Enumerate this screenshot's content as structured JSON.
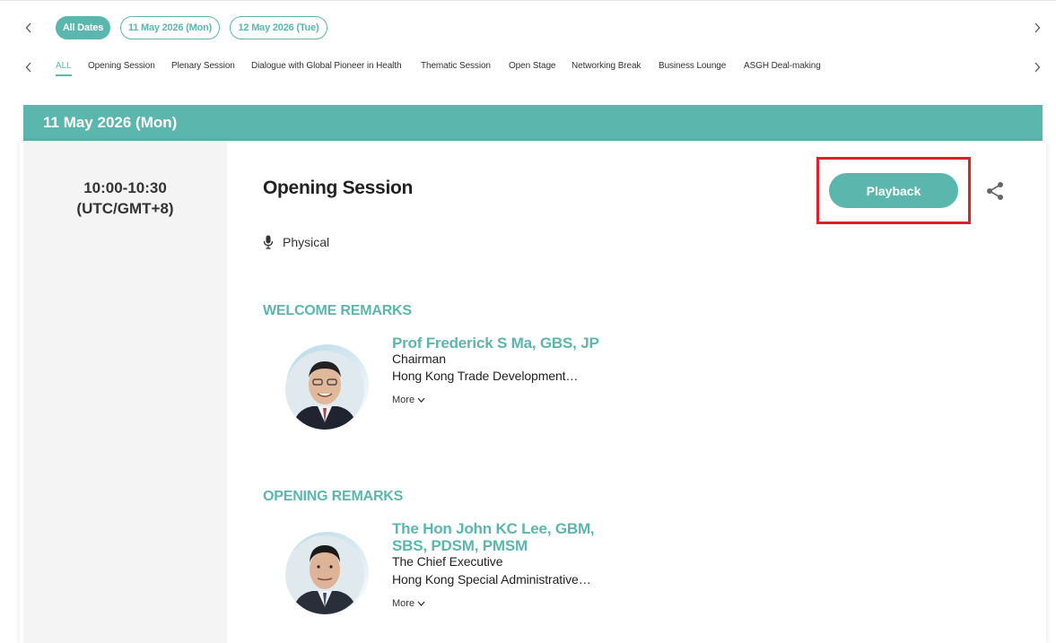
{
  "date_filters": {
    "prev_label": "‹",
    "next_label": "›",
    "items": [
      {
        "label": "All Dates",
        "active": true
      },
      {
        "label": "11 May 2026 (Mon)",
        "active": false
      },
      {
        "label": "12 May 2026 (Tue)",
        "active": false
      }
    ]
  },
  "category_tabs": {
    "items": [
      {
        "label": "ALL",
        "active": true
      },
      {
        "label": "Opening Session"
      },
      {
        "label": "Plenary Session"
      },
      {
        "label": "Dialogue with Global Pioneer in Health"
      },
      {
        "label": "Thematic Session"
      },
      {
        "label": "Open Stage"
      },
      {
        "label": "Networking Break"
      },
      {
        "label": "Business Lounge"
      },
      {
        "label": "ASGH Deal-making"
      }
    ]
  },
  "day": {
    "header": "11 May 2026 (Mon)"
  },
  "session": {
    "time_line1": "10:00-10:30",
    "time_line2": "(UTC/GMT+8)",
    "title": "Opening Session",
    "playback_label": "Playback",
    "format": "Physical",
    "icons": {
      "share": "share-icon",
      "format": "microphone-icon"
    },
    "sections": [
      {
        "heading": "WELCOME REMARKS",
        "speaker": {
          "name": "Prof Frederick S Ma, GBS, JP",
          "role": "Chairman",
          "org": "Hong Kong Trade Development…",
          "more_label": "More"
        }
      },
      {
        "heading": "OPENING REMARKS",
        "speaker": {
          "name_line1": "The Hon John KC Lee, GBM,",
          "name_line2": "SBS, PDSM, PMSM",
          "role": "The Chief Executive",
          "org": "Hong Kong Special Administrative…",
          "more_label": "More"
        }
      }
    ]
  },
  "colors": {
    "accent": "#5bb7ae",
    "highlight": "#d8232a",
    "time_column_bg": "#f4f4f4"
  }
}
